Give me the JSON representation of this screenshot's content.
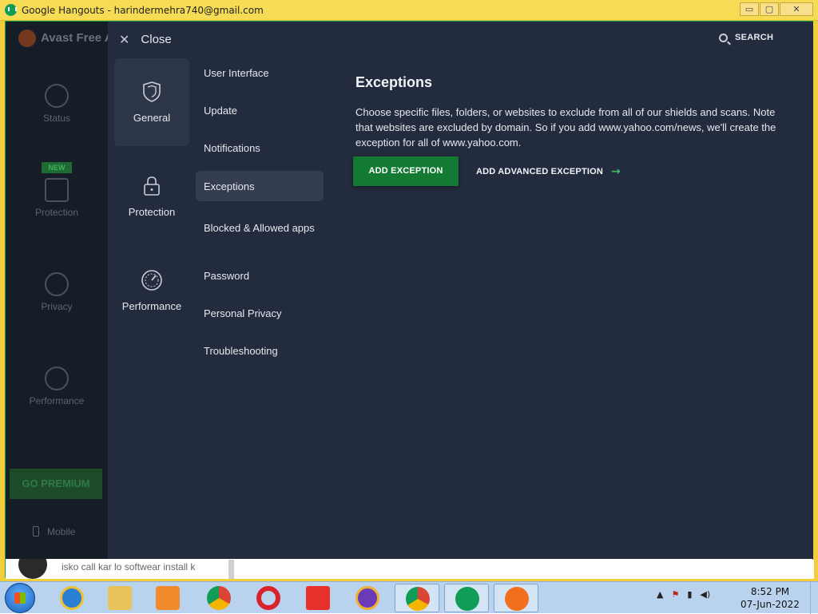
{
  "window": {
    "title": "Google Hangouts - harindermehra740@gmail.com",
    "min_glyph": "▭",
    "max_glyph": "▢",
    "close_glyph": "✕"
  },
  "avast_main": {
    "brand": "Avast Free A",
    "nav": [
      {
        "label": "Status",
        "icon": "check-circle-icon"
      },
      {
        "label": "Protection",
        "icon": "lock-icon",
        "badge": "NEW"
      },
      {
        "label": "Privacy",
        "icon": "fingerprint-icon"
      },
      {
        "label": "Performance",
        "icon": "speedometer-icon"
      }
    ],
    "go_premium": "GO PREMIUM",
    "mobile": "Mobile"
  },
  "settings": {
    "close_label": "Close",
    "search_label": "SEARCH",
    "categories": [
      {
        "label": "General",
        "icon": "shield-icon",
        "active": true
      },
      {
        "label": "Protection",
        "icon": "lock-icon",
        "active": false
      },
      {
        "label": "Performance",
        "icon": "speedometer-icon",
        "active": false
      }
    ],
    "submenu": [
      {
        "label": "User Interface"
      },
      {
        "label": "Update"
      },
      {
        "label": "Notifications"
      },
      {
        "label": "Exceptions",
        "active": true
      },
      {
        "label": "Blocked & Allowed apps"
      },
      {
        "label": "Password"
      },
      {
        "label": "Personal Privacy"
      },
      {
        "label": "Troubleshooting"
      }
    ],
    "content": {
      "title": "Exceptions",
      "description": "Choose specific files, folders, or websites to exclude from all of our shields and scans. Note that websites are excluded by domain. So if you add www.yahoo.com/news, we'll create the exception for all of www.yahoo.com.",
      "add_button": "ADD EXCEPTION",
      "advanced_button": "ADD ADVANCED EXCEPTION"
    }
  },
  "chat": {
    "preview": "isko call kar lo softwear install k"
  },
  "taskbar": {
    "apps": [
      "ie-icon",
      "file-explorer-icon",
      "media-player-icon",
      "chrome-icon",
      "opera-icon",
      "anydesk-icon",
      "avast-secure-browser-icon",
      "chrome-running-icon",
      "hangouts-running-icon",
      "avast-running-icon"
    ],
    "clock_time": "8:52 PM",
    "clock_date": "07-Jun-2022"
  },
  "colors": {
    "settings_bg": "#232b3e",
    "accent_green": "#127a33",
    "titlebar_yellow": "#f6dc55"
  }
}
